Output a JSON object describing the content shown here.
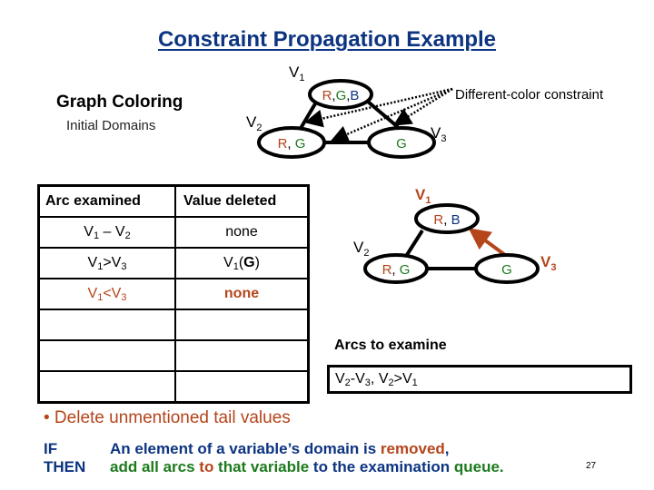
{
  "title": "Constraint Propagation Example",
  "left_panel": {
    "heading": "Graph Coloring",
    "subheading": "Initial Domains"
  },
  "colors": {
    "title": "#0d3481",
    "red_value": "#b5451b",
    "green_value": "#1d7a1d",
    "blue_value": "#0d3481",
    "highlight_arc": "#b5451b"
  },
  "initial_graph": {
    "nodes": [
      {
        "id": "V1",
        "label": "V",
        "sub": "1",
        "domain": [
          "R",
          "G",
          "B"
        ]
      },
      {
        "id": "V2",
        "label": "V",
        "sub": "2",
        "domain": [
          "R",
          "G"
        ]
      },
      {
        "id": "V3",
        "label": "V",
        "sub": "3",
        "domain": [
          "G"
        ]
      }
    ],
    "edges": [
      [
        "V1",
        "V2"
      ],
      [
        "V1",
        "V3"
      ],
      [
        "V2",
        "V3"
      ]
    ],
    "constraint_label": "Different-color constraint"
  },
  "current_graph": {
    "nodes": [
      {
        "id": "V1",
        "label": "V",
        "sub": "1",
        "domain": [
          "R",
          "B"
        ]
      },
      {
        "id": "V2",
        "label": "V",
        "sub": "2",
        "domain": [
          "R",
          "G"
        ]
      },
      {
        "id": "V3",
        "label": "V",
        "sub": "3",
        "domain": [
          "G"
        ]
      }
    ],
    "highlighted_arc": {
      "from": "V3",
      "to": "V1"
    }
  },
  "arc_table": {
    "headers": [
      "Arc  examined",
      "Value deleted"
    ],
    "rows": [
      {
        "arc": [
          "V",
          "1",
          " – ",
          "V",
          "2"
        ],
        "deleted": "none"
      },
      {
        "arc": [
          "V",
          "1",
          ">",
          "V",
          "3"
        ],
        "deleted_var": "V",
        "deleted_sub": "1",
        "deleted_val": "G"
      },
      {
        "arc": [
          "V",
          "1",
          "<",
          "V",
          "3"
        ],
        "deleted": "none",
        "highlight": true
      },
      {
        "arc": [],
        "deleted": ""
      },
      {
        "arc": [],
        "deleted": ""
      },
      {
        "arc": [],
        "deleted": ""
      }
    ]
  },
  "arcs_to_examine": {
    "heading": "Arcs to examine",
    "queue": "V2-V3, V2>V1"
  },
  "bullet": "• Delete unmentioned tail values",
  "rule": {
    "if_label": "IF",
    "then_label": "THEN",
    "if_text_1": "An element of a variable’s domain is ",
    "if_text_2": "removed",
    "if_text_3": ",",
    "then_text_1": "add all arcs ",
    "then_text_2": "to",
    "then_text_3": " that variable",
    "then_text_4": " to the examination ",
    "then_text_5": "queue."
  },
  "page_number": "27"
}
